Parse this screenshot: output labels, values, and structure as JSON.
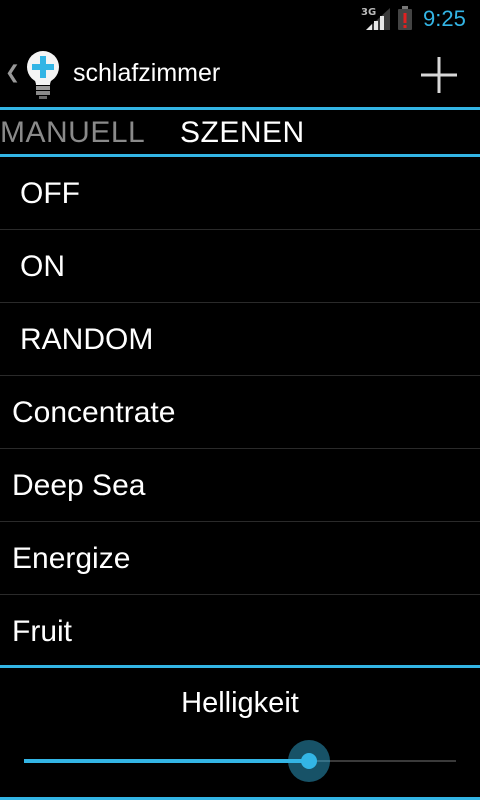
{
  "status_bar": {
    "network_type": "3G",
    "signal_icon": "signal-bars-icon",
    "battery_icon": "battery-alert-icon",
    "time": "9:25"
  },
  "action_bar": {
    "up_icon": "chevron-left-icon",
    "app_icon": "lightbulb-plus-icon",
    "title": "schlafzimmer",
    "add_icon": "plus-icon"
  },
  "tabs": [
    {
      "label": "MANUELL",
      "selected": false
    },
    {
      "label": "SZENEN",
      "selected": true
    }
  ],
  "scenes": [
    {
      "label": "OFF",
      "kind": "builtin"
    },
    {
      "label": "ON",
      "kind": "builtin"
    },
    {
      "label": "RANDOM",
      "kind": "builtin"
    },
    {
      "label": "Concentrate",
      "kind": "custom"
    },
    {
      "label": "Deep Sea",
      "kind": "custom"
    },
    {
      "label": "Energize",
      "kind": "custom"
    },
    {
      "label": "Fruit",
      "kind": "custom"
    }
  ],
  "brightness": {
    "title": "Helligkeit",
    "value_fraction": 0.66
  },
  "colors": {
    "accent": "#33b5e5",
    "background": "#000000",
    "tab_inactive": "#8a8a8a"
  }
}
